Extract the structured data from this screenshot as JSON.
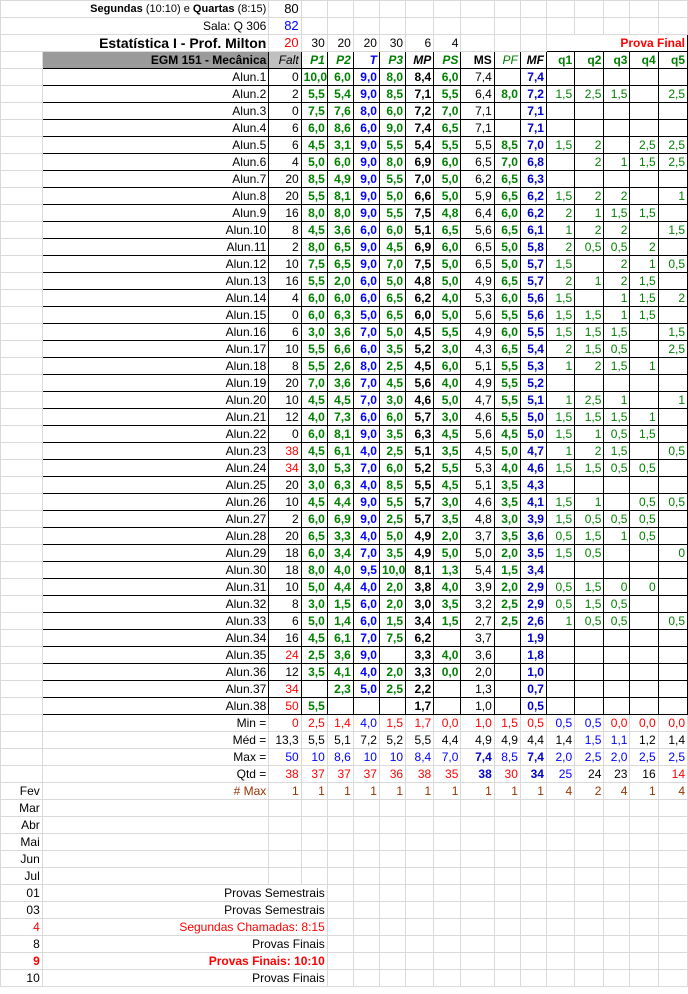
{
  "header": {
    "schedule_days": "Segundas",
    "schedule_time1": "(10:10)",
    "schedule_sep": "e",
    "schedule_days2": "Quartas",
    "schedule_time2": "(8:15)",
    "schedule_count": "80",
    "room_label": "Sala: Q 306",
    "room_count": "82",
    "course_title": "Estatística I - Prof. Milton",
    "course_count": "20",
    "weights": [
      "30",
      "20",
      "20",
      "30",
      "6",
      "4"
    ],
    "prova_final_label": "Prova Final"
  },
  "columns": {
    "class_name": "EGM 151 - Mecânica",
    "falt": "Falt",
    "p1": "P1",
    "p2": "P2",
    "t": "T",
    "p3": "P3",
    "mp": "MP",
    "ps": "PS",
    "ms": "MS",
    "pf": "PF",
    "mf": "MF",
    "q1": "q1",
    "q2": "q2",
    "q3": "q3",
    "q4": "q4",
    "q5": "q5"
  },
  "students": [
    {
      "name": "Alun.1",
      "falt": "0",
      "p1": "10,0",
      "p2": "6,0",
      "t": "9,0",
      "p3": "8,0",
      "mp": "8,4",
      "ps": "6,0",
      "ms": "7,4",
      "pf": "",
      "mf": "7,4",
      "q1": "",
      "q2": "",
      "q3": "",
      "q4": "",
      "q5": ""
    },
    {
      "name": "Alun.2",
      "falt": "2",
      "p1": "5,5",
      "p2": "5,4",
      "t": "9,0",
      "p3": "8,5",
      "mp": "7,1",
      "ps": "5,5",
      "ms": "6,4",
      "pf": "8,0",
      "mf": "7,2",
      "q1": "1,5",
      "q2": "2,5",
      "q3": "1,5",
      "q4": "",
      "q5": "2,5"
    },
    {
      "name": "Alun.3",
      "falt": "0",
      "p1": "7,5",
      "p2": "7,6",
      "t": "8,0",
      "p3": "6,0",
      "mp": "7,2",
      "ps": "7,0",
      "ms": "7,1",
      "pf": "",
      "mf": "7,1",
      "q1": "",
      "q2": "",
      "q3": "",
      "q4": "",
      "q5": ""
    },
    {
      "name": "Alun.4",
      "falt": "6",
      "p1": "6,0",
      "p2": "8,6",
      "t": "6,0",
      "p3": "9,0",
      "mp": "7,4",
      "ps": "6,5",
      "ms": "7,1",
      "pf": "",
      "mf": "7,1",
      "q1": "",
      "q2": "",
      "q3": "",
      "q4": "",
      "q5": ""
    },
    {
      "name": "Alun.5",
      "falt": "6",
      "p1": "4,5",
      "p2": "3,1",
      "t": "9,0",
      "p3": "5,5",
      "mp": "5,4",
      "ps": "5,5",
      "ms": "5,5",
      "pf": "8,5",
      "mf": "7,0",
      "q1": "1,5",
      "q2": "2",
      "q3": "",
      "q4": "2,5",
      "q5": "2,5"
    },
    {
      "name": "Alun.6",
      "falt": "4",
      "p1": "5,0",
      "p2": "6,0",
      "t": "9,0",
      "p3": "8,0",
      "mp": "6,9",
      "ps": "6,0",
      "ms": "6,5",
      "pf": "7,0",
      "mf": "6,8",
      "q1": "",
      "q2": "2",
      "q3": "1",
      "q4": "1,5",
      "q5": "2,5"
    },
    {
      "name": "Alun.7",
      "falt": "20",
      "p1": "8,5",
      "p2": "4,9",
      "t": "9,0",
      "p3": "5,5",
      "mp": "7,0",
      "ps": "5,0",
      "ms": "6,2",
      "pf": "6,5",
      "mf": "6,3",
      "q1": "",
      "q2": "",
      "q3": "",
      "q4": "",
      "q5": ""
    },
    {
      "name": "Alun.8",
      "falt": "20",
      "p1": "5,5",
      "p2": "8,1",
      "t": "9,0",
      "p3": "5,0",
      "mp": "6,6",
      "ps": "5,0",
      "ms": "5,9",
      "pf": "6,5",
      "mf": "6,2",
      "q1": "1,5",
      "q2": "2",
      "q3": "2",
      "q4": "",
      "q5": "1"
    },
    {
      "name": "Alun.9",
      "falt": "16",
      "p1": "8,0",
      "p2": "8,0",
      "t": "9,0",
      "p3": "5,5",
      "mp": "7,5",
      "ps": "4,8",
      "ms": "6,4",
      "pf": "6,0",
      "mf": "6,2",
      "q1": "2",
      "q2": "1",
      "q3": "1,5",
      "q4": "1,5",
      "q5": ""
    },
    {
      "name": "Alun.10",
      "falt": "8",
      "p1": "4,5",
      "p2": "3,6",
      "t": "6,0",
      "p3": "6,0",
      "mp": "5,1",
      "ps": "6,5",
      "ms": "5,6",
      "pf": "6,5",
      "mf": "6,1",
      "q1": "1",
      "q2": "2",
      "q3": "2",
      "q4": "",
      "q5": "1,5"
    },
    {
      "name": "Alun.11",
      "falt": "2",
      "p1": "8,0",
      "p2": "6,5",
      "t": "9,0",
      "p3": "4,5",
      "mp": "6,9",
      "ps": "6,0",
      "ms": "6,5",
      "pf": "5,0",
      "mf": "5,8",
      "q1": "2",
      "q2": "0,5",
      "q3": "0,5",
      "q4": "2",
      "q5": ""
    },
    {
      "name": "Alun.12",
      "falt": "10",
      "p1": "7,5",
      "p2": "6,5",
      "t": "9,0",
      "p3": "7,0",
      "mp": "7,5",
      "ps": "5,0",
      "ms": "6,5",
      "pf": "5,0",
      "mf": "5,7",
      "q1": "1,5",
      "q2": "",
      "q3": "2",
      "q4": "1",
      "q5": "0,5"
    },
    {
      "name": "Alun.13",
      "falt": "16",
      "p1": "5,5",
      "p2": "2,0",
      "t": "6,0",
      "p3": "5,0",
      "mp": "4,8",
      "ps": "5,0",
      "ms": "4,9",
      "pf": "6,5",
      "mf": "5,7",
      "q1": "2",
      "q2": "1",
      "q3": "2",
      "q4": "1,5",
      "q5": ""
    },
    {
      "name": "Alun.14",
      "falt": "4",
      "p1": "6,0",
      "p2": "6,0",
      "t": "6,0",
      "p3": "6,5",
      "mp": "6,2",
      "ps": "4,0",
      "ms": "5,3",
      "pf": "6,0",
      "mf": "5,6",
      "q1": "1,5",
      "q2": "",
      "q3": "1",
      "q4": "1,5",
      "q5": "2"
    },
    {
      "name": "Alun.15",
      "falt": "0",
      "p1": "6,0",
      "p2": "6,3",
      "t": "5,0",
      "p3": "6,5",
      "mp": "6,0",
      "ps": "5,0",
      "ms": "5,6",
      "pf": "5,5",
      "mf": "5,6",
      "q1": "1,5",
      "q2": "1,5",
      "q3": "1",
      "q4": "1,5",
      "q5": ""
    },
    {
      "name": "Alun.16",
      "falt": "6",
      "p1": "3,0",
      "p2": "3,6",
      "t": "7,0",
      "p3": "5,0",
      "mp": "4,5",
      "ps": "5,5",
      "ms": "4,9",
      "pf": "6,0",
      "mf": "5,5",
      "q1": "1,5",
      "q2": "1,5",
      "q3": "1,5",
      "q4": "",
      "q5": "1,5"
    },
    {
      "name": "Alun.17",
      "falt": "10",
      "p1": "5,5",
      "p2": "6,6",
      "t": "6,0",
      "p3": "3,5",
      "mp": "5,2",
      "ps": "3,0",
      "ms": "4,3",
      "pf": "6,5",
      "mf": "5,4",
      "q1": "2",
      "q2": "1,5",
      "q3": "0,5",
      "q4": "",
      "q5": "2,5"
    },
    {
      "name": "Alun.18",
      "falt": "8",
      "p1": "5,5",
      "p2": "2,6",
      "t": "8,0",
      "p3": "2,5",
      "mp": "4,5",
      "ps": "6,0",
      "ms": "5,1",
      "pf": "5,5",
      "mf": "5,3",
      "q1": "1",
      "q2": "2",
      "q3": "1,5",
      "q4": "1",
      "q5": ""
    },
    {
      "name": "Alun.19",
      "falt": "20",
      "p1": "7,0",
      "p2": "3,6",
      "t": "7,0",
      "p3": "4,5",
      "mp": "5,6",
      "ps": "4,0",
      "ms": "4,9",
      "pf": "5,5",
      "mf": "5,2",
      "q1": "",
      "q2": "",
      "q3": "",
      "q4": "",
      "q5": ""
    },
    {
      "name": "Alun.20",
      "falt": "10",
      "p1": "4,5",
      "p2": "4,5",
      "t": "7,0",
      "p3": "3,0",
      "mp": "4,6",
      "ps": "5,0",
      "ms": "4,7",
      "pf": "5,5",
      "mf": "5,1",
      "q1": "1",
      "q2": "2,5",
      "q3": "1",
      "q4": "",
      "q5": "1"
    },
    {
      "name": "Alun.21",
      "falt": "12",
      "p1": "4,0",
      "p2": "7,3",
      "t": "6,0",
      "p3": "6,0",
      "mp": "5,7",
      "ps": "3,0",
      "ms": "4,6",
      "pf": "5,5",
      "mf": "5,0",
      "q1": "1,5",
      "q2": "1,5",
      "q3": "1,5",
      "q4": "1",
      "q5": ""
    },
    {
      "name": "Alun.22",
      "falt": "0",
      "p1": "6,0",
      "p2": "8,1",
      "t": "9,0",
      "p3": "3,5",
      "mp": "6,3",
      "ps": "4,5",
      "ms": "5,6",
      "pf": "4,5",
      "mf": "5,0",
      "q1": "1,5",
      "q2": "1",
      "q3": "0,5",
      "q4": "1,5",
      "q5": ""
    },
    {
      "name": "Alun.23",
      "falt": "38",
      "p1": "4,5",
      "p2": "6,1",
      "t": "4,0",
      "p3": "2,5",
      "mp": "5,1",
      "ps": "3,5",
      "ms": "4,5",
      "pf": "5,0",
      "mf": "4,7",
      "q1": "1",
      "q2": "2",
      "q3": "1,5",
      "q4": "",
      "q5": "0,5"
    },
    {
      "name": "Alun.24",
      "falt": "34",
      "p1": "3,0",
      "p2": "5,3",
      "t": "7,0",
      "p3": "6,0",
      "mp": "5,2",
      "ps": "5,5",
      "ms": "5,3",
      "pf": "4,0",
      "mf": "4,6",
      "q1": "1,5",
      "q2": "1,5",
      "q3": "0,5",
      "q4": "0,5",
      "q5": ""
    },
    {
      "name": "Alun.25",
      "falt": "20",
      "p1": "3,0",
      "p2": "6,3",
      "t": "4,0",
      "p3": "8,5",
      "mp": "5,5",
      "ps": "4,5",
      "ms": "5,1",
      "pf": "3,5",
      "mf": "4,3",
      "q1": "",
      "q2": "",
      "q3": "",
      "q4": "",
      "q5": ""
    },
    {
      "name": "Alun.26",
      "falt": "10",
      "p1": "4,5",
      "p2": "4,4",
      "t": "9,0",
      "p3": "5,5",
      "mp": "5,7",
      "ps": "3,0",
      "ms": "4,6",
      "pf": "3,5",
      "mf": "4,1",
      "q1": "1,5",
      "q2": "1",
      "q3": "",
      "q4": "0,5",
      "q5": "0,5"
    },
    {
      "name": "Alun.27",
      "falt": "2",
      "p1": "6,0",
      "p2": "6,9",
      "t": "9,0",
      "p3": "2,5",
      "mp": "5,7",
      "ps": "3,5",
      "ms": "4,8",
      "pf": "3,0",
      "mf": "3,9",
      "q1": "1,5",
      "q2": "0,5",
      "q3": "0,5",
      "q4": "0,5",
      "q5": ""
    },
    {
      "name": "Alun.28",
      "falt": "20",
      "p1": "6,5",
      "p2": "3,3",
      "t": "4,0",
      "p3": "5,0",
      "mp": "4,9",
      "ps": "2,0",
      "ms": "3,7",
      "pf": "3,5",
      "mf": "3,6",
      "q1": "0,5",
      "q2": "1,5",
      "q3": "1",
      "q4": "0,5",
      "q5": ""
    },
    {
      "name": "Alun.29",
      "falt": "18",
      "p1": "6,0",
      "p2": "3,4",
      "t": "7,0",
      "p3": "3,5",
      "mp": "4,9",
      "ps": "5,0",
      "ms": "5,0",
      "pf": "2,0",
      "mf": "3,5",
      "q1": "1,5",
      "q2": "0,5",
      "q3": "",
      "q4": "",
      "q5": "0"
    },
    {
      "name": "Alun.30",
      "falt": "18",
      "p1": "8,0",
      "p2": "4,0",
      "t": "9,5",
      "p3": "10,0",
      "mp": "8,1",
      "ps": "1,3",
      "ms": "5,4",
      "pf": "1,5",
      "mf": "3,4",
      "q1": "",
      "q2": "",
      "q3": "",
      "q4": "",
      "q5": ""
    },
    {
      "name": "Alun.31",
      "falt": "10",
      "p1": "5,0",
      "p2": "4,4",
      "t": "4,0",
      "p3": "2,0",
      "mp": "3,8",
      "ps": "4,0",
      "ms": "3,9",
      "pf": "2,0",
      "mf": "2,9",
      "q1": "0,5",
      "q2": "1,5",
      "q3": "0",
      "q4": "0",
      "q5": ""
    },
    {
      "name": "Alun.32",
      "falt": "8",
      "p1": "3,0",
      "p2": "1,5",
      "t": "6,0",
      "p3": "2,0",
      "mp": "3,0",
      "ps": "3,5",
      "ms": "3,2",
      "pf": "2,5",
      "mf": "2,9",
      "q1": "0,5",
      "q2": "1,5",
      "q3": "0,5",
      "q4": "",
      "q5": ""
    },
    {
      "name": "Alun.33",
      "falt": "6",
      "p1": "5,0",
      "p2": "1,4",
      "t": "6,0",
      "p3": "1,5",
      "mp": "3,4",
      "ps": "1,5",
      "ms": "2,7",
      "pf": "2,5",
      "mf": "2,6",
      "q1": "1",
      "q2": "0,5",
      "q3": "0,5",
      "q4": "",
      "q5": "0,5"
    },
    {
      "name": "Alun.34",
      "falt": "16",
      "p1": "4,5",
      "p2": "6,1",
      "t": "7,0",
      "p3": "7,5",
      "mp": "6,2",
      "ps": "",
      "ms": "3,7",
      "pf": "",
      "mf": "1,9",
      "q1": "",
      "q2": "",
      "q3": "",
      "q4": "",
      "q5": ""
    },
    {
      "name": "Alun.35",
      "falt": "24",
      "p1": "2,5",
      "p2": "3,6",
      "t": "9,0",
      "p3": "",
      "mp": "3,3",
      "ps": "4,0",
      "ms": "3,6",
      "pf": "",
      "mf": "1,8",
      "q1": "",
      "q2": "",
      "q3": "",
      "q4": "",
      "q5": ""
    },
    {
      "name": "Alun.36",
      "falt": "12",
      "p1": "3,5",
      "p2": "4,1",
      "t": "4,0",
      "p3": "2,0",
      "mp": "3,3",
      "ps": "0,0",
      "ms": "2,0",
      "pf": "",
      "mf": "1,0",
      "q1": "",
      "q2": "",
      "q3": "",
      "q4": "",
      "q5": ""
    },
    {
      "name": "Alun.37",
      "falt": "34",
      "p1": "",
      "p2": "2,3",
      "t": "5,0",
      "p3": "2,5",
      "mp": "2,2",
      "ps": "",
      "ms": "1,3",
      "pf": "",
      "mf": "0,7",
      "q1": "",
      "q2": "",
      "q3": "",
      "q4": "",
      "q5": ""
    },
    {
      "name": "Alun.38",
      "falt": "50",
      "p1": "5,5",
      "p2": "",
      "t": "",
      "p3": "",
      "mp": "1,7",
      "ps": "",
      "ms": "1,0",
      "pf": "",
      "mf": "0,5",
      "q1": "",
      "q2": "",
      "q3": "",
      "q4": "",
      "q5": ""
    }
  ],
  "stats": [
    {
      "label": "Min =",
      "falt": "0",
      "p1": "2,5",
      "p2": "1,4",
      "t": "4,0",
      "p3": "1,5",
      "mp": "1,7",
      "ps": "0,0",
      "ms": "1,0",
      "pf": "1,5",
      "mf": "0,5",
      "q1": "0,5",
      "q2": "0,5",
      "q3": "0,0",
      "q4": "0,0",
      "q5": "0,0"
    },
    {
      "label": "Méd =",
      "falt": "13,3",
      "p1": "5,5",
      "p2": "5,1",
      "t": "7,2",
      "p3": "5,2",
      "mp": "5,5",
      "ps": "4,4",
      "ms": "4,9",
      "pf": "4,9",
      "mf": "4,4",
      "q1": "1,4",
      "q2": "1,5",
      "q3": "1,1",
      "q4": "1,2",
      "q5": "1,4"
    },
    {
      "label": "Max =",
      "falt": "50",
      "p1": "10",
      "p2": "8,6",
      "t": "10",
      "p3": "10",
      "mp": "8,4",
      "ps": "7,0",
      "ms": "7,4",
      "pf": "8,5",
      "mf": "7,4",
      "q1": "2,0",
      "q2": "2,5",
      "q3": "2,0",
      "q4": "2,5",
      "q5": "2,5"
    },
    {
      "label": "Qtd =",
      "falt": "38",
      "p1": "37",
      "p2": "37",
      "t": "37",
      "p3": "36",
      "mp": "38",
      "ps": "35",
      "ms": "38",
      "pf": "30",
      "mf": "34",
      "q1": "25",
      "q2": "24",
      "q3": "23",
      "q4": "16",
      "q5": "14"
    },
    {
      "label": "# Max",
      "falt": "1",
      "p1": "1",
      "p2": "1",
      "t": "1",
      "p3": "1",
      "mp": "1",
      "ps": "1",
      "ms": "1",
      "pf": "1",
      "mf": "1",
      "q1": "4",
      "q2": "2",
      "q3": "4",
      "q4": "1",
      "q5": "4"
    }
  ],
  "months": [
    "Fev",
    "Mar",
    "Abr",
    "Mai",
    "Jun",
    "Jul"
  ],
  "schedule": [
    {
      "day": "01",
      "text": "Provas Semestrais"
    },
    {
      "day": "03",
      "text": "Provas Semestrais"
    },
    {
      "day": "4",
      "text": "Segundas Chamadas: 8:15"
    },
    {
      "day": "8",
      "text": "Provas Finais"
    },
    {
      "day": "9",
      "text": "Provas Finais: 10:10"
    },
    {
      "day": "10",
      "text": "Provas Finais"
    }
  ],
  "colors": {
    "green": "#008000",
    "blue": "#0000ff",
    "red": "#ff0000",
    "brown": "#993300",
    "header_gray": "#9a9a9a"
  }
}
